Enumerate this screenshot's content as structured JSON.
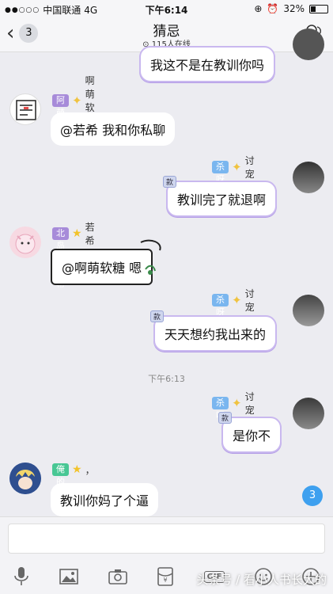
{
  "status": {
    "carrier": "中国联通",
    "network": "4G",
    "time": "下午6:14",
    "battery": "32%"
  },
  "nav": {
    "back_count": "3",
    "title": "猜忌",
    "online": "115人在线"
  },
  "messages": [
    {
      "text": "我这不是在教训你吗"
    },
    {
      "tag": "阿萌软糖",
      "name": "啊萌软糖",
      "text": "@若希 我和你私聊"
    },
    {
      "tag": "杀呀",
      "name": "讨宠",
      "text": "教训完了就退啊",
      "badge": "款"
    },
    {
      "tag": "北岛的希希",
      "name": "若希",
      "text": "@啊萌软糖 嗯"
    },
    {
      "tag": "杀呀",
      "name": "讨宠",
      "text": "天天想约我出来的",
      "badge": "款"
    },
    {
      "tag": "杀呀",
      "name": "讨宠",
      "text": "是你不",
      "badge": "款"
    },
    {
      "tag": "俺的许",
      "name": "，",
      "text": "教训你妈了个逼"
    }
  ],
  "timestamp": "下午6:13",
  "unread_count": "3",
  "toolbar": [
    "mic-icon",
    "image-icon",
    "camera-icon",
    "redpacket-icon",
    "gif-icon",
    "emoji-icon",
    "plus-icon"
  ],
  "gif_label": "GIF",
  "watermark": "头条号 / 看小人书长大的",
  "colors": {
    "tag_purple": "#a78bd9",
    "tag_blue": "#7ab6ef",
    "tag_green": "#48c794",
    "unread": "#3ea0ef"
  }
}
